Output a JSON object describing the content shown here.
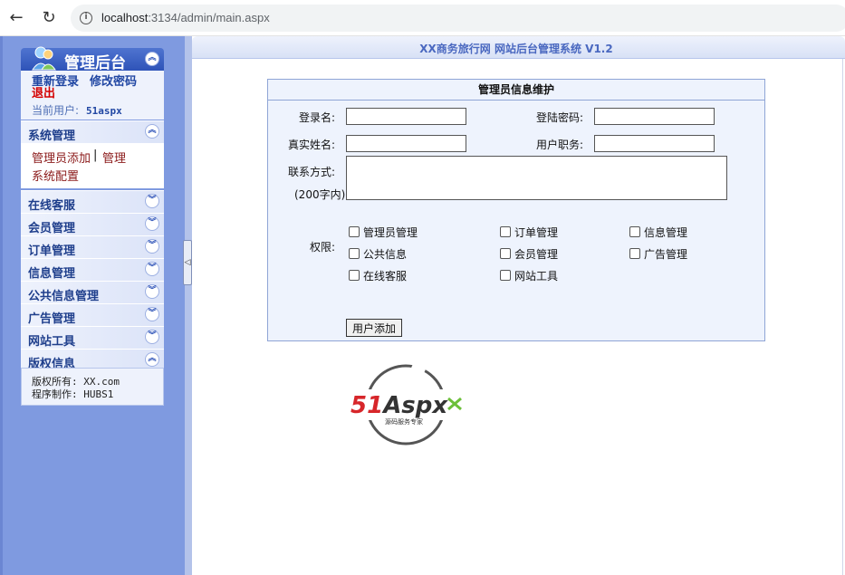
{
  "browser": {
    "back_icon": "←",
    "reload_icon": "↻",
    "url_host": "localhost",
    "url_rest": ":3134/admin/main.aspx"
  },
  "sidebar": {
    "title": "管理后台",
    "relogin": "重新登录",
    "change_password": "修改密码",
    "logout": "退出",
    "current_user_label": "当前用户:",
    "current_user": "51aspx",
    "sections": [
      {
        "label": "系统管理"
      },
      {
        "label": "在线客服"
      },
      {
        "label": "会员管理"
      },
      {
        "label": "订单管理"
      },
      {
        "label": "信息管理"
      },
      {
        "label": "公共信息管理"
      },
      {
        "label": "广告管理"
      },
      {
        "label": "网站工具"
      },
      {
        "label": "版权信息"
      }
    ],
    "system_sub": {
      "admin_add": "管理员添加",
      "separator": "|",
      "manage": "管理",
      "config": "系统配置"
    },
    "footer": {
      "copyright": "版权所有: XX.com",
      "author": "程序制作: HUBS1"
    }
  },
  "main": {
    "system_title": "XX商务旅行网 网站后台管理系统 V1.2",
    "form": {
      "title": "管理员信息维护",
      "login_name_label": "登录名:",
      "login_name_value": "",
      "password_label": "登陆密码:",
      "password_value": "",
      "real_name_label": "真实姓名:",
      "real_name_value": "",
      "position_label": "用户职务:",
      "position_value": "",
      "contact_label": "联系方式:",
      "contact_hint": "(200字内)",
      "contact_value": "",
      "permissions_label": "权限:",
      "permissions": [
        {
          "label": "管理员管理",
          "checked": false
        },
        {
          "label": "订单管理",
          "checked": false
        },
        {
          "label": "信息管理",
          "checked": false
        },
        {
          "label": "公共信息",
          "checked": false
        },
        {
          "label": "会员管理",
          "checked": false
        },
        {
          "label": "广告管理",
          "checked": false
        },
        {
          "label": "在线客服",
          "checked": false
        },
        {
          "label": "网站工具",
          "checked": false
        }
      ],
      "submit_label": "用户添加"
    },
    "logo": {
      "brand": "51Aspx",
      "tagline": "源码服务专家"
    }
  },
  "colors": {
    "sidebar_bg": "#7f9ae0",
    "link_blue": "#2147a3",
    "logout_red": "#d40000",
    "sub_link": "#8b1a1a",
    "title_blue": "#4a68c0"
  }
}
